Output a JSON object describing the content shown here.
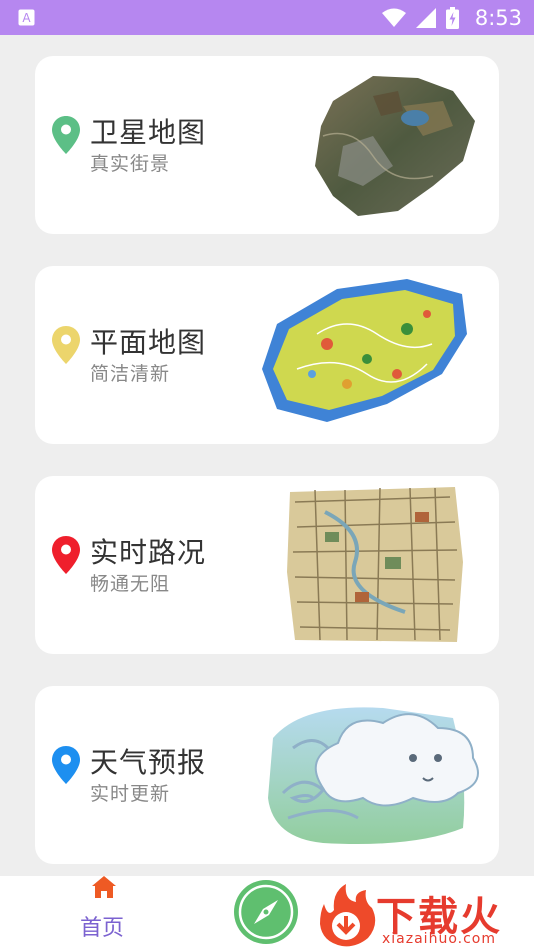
{
  "status_bar": {
    "time": "8:53"
  },
  "cards": [
    {
      "title": "卫星地图",
      "subtitle": "真实街景",
      "pin_color": "#5cbf86"
    },
    {
      "title": "平面地图",
      "subtitle": "简洁清新",
      "pin_color": "#ecd56c"
    },
    {
      "title": "实时路况",
      "subtitle": "畅通无阻",
      "pin_color": "#ef1f2c"
    },
    {
      "title": "天气预报",
      "subtitle": "实时更新",
      "pin_color": "#1d8ff0"
    }
  ],
  "bottom_nav": {
    "home_label": "首页",
    "accent": "#7b62d0",
    "compass_color": "#5fbf6f"
  },
  "watermark": {
    "text": "下载火",
    "url": "xiazaihuo.com"
  }
}
